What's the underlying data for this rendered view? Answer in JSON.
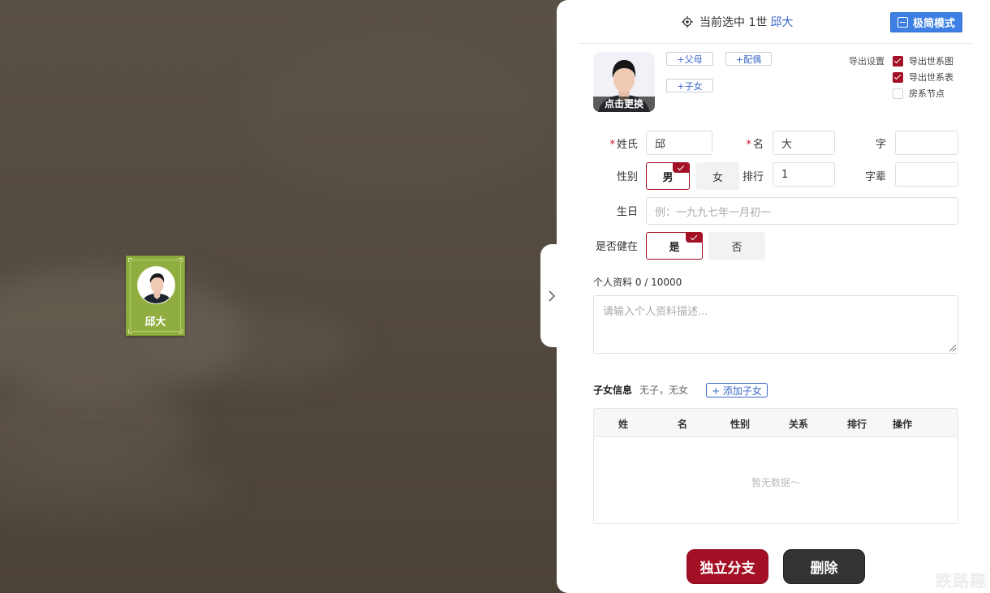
{
  "colors": {
    "node_bg": "#8fae3f",
    "accent_red": "#a31026",
    "accent_blue": "#3d7fe3",
    "link_blue": "#3b67c9",
    "delete_btn": "#333333"
  },
  "tree": {
    "node": {
      "name": "邱大",
      "avatar_icon": "male-avatar-icon"
    }
  },
  "panel": {
    "header": {
      "selected_prefix": "当前选中 1世",
      "selected_name": "邱大",
      "mode_button": "极简模式"
    },
    "photo": {
      "caption": "点击更换"
    },
    "relation_buttons": {
      "parents": "+父母",
      "spouse": "+配偶",
      "children": "+子女"
    },
    "export": {
      "label": "导出设置",
      "options": [
        {
          "label": "导出世系图",
          "checked": true
        },
        {
          "label": "导出世系表",
          "checked": true
        },
        {
          "label": "房系节点",
          "checked": false
        }
      ]
    },
    "form": {
      "surname": {
        "label": "姓氏",
        "value": "邱"
      },
      "given_name": {
        "label": "名",
        "value": "大"
      },
      "courtesy": {
        "label": "字",
        "value": ""
      },
      "gender": {
        "label": "性别",
        "options": [
          "男",
          "女"
        ],
        "selected": "男"
      },
      "rank": {
        "label": "排行",
        "value": "1"
      },
      "generation_name": {
        "label": "字辈",
        "value": ""
      },
      "birthday": {
        "label": "生日",
        "placeholder": "例：一九九七年一月初一"
      },
      "alive": {
        "label": "是否健在",
        "options": [
          "是",
          "否"
        ],
        "selected": "是"
      },
      "bio": {
        "label": "个人资料 0 / 10000",
        "placeholder": "请输入个人资料描述..."
      }
    },
    "children": {
      "title": "子女信息",
      "status": "无子，无女",
      "add_button": "+ 添加子女",
      "columns": [
        "姓",
        "名",
        "性别",
        "关系",
        "排行",
        "操作"
      ],
      "empty_text": "暂无数据～"
    },
    "actions": {
      "branch": "独立分支",
      "delete": "删除"
    }
  },
  "watermark": "跌路趣"
}
